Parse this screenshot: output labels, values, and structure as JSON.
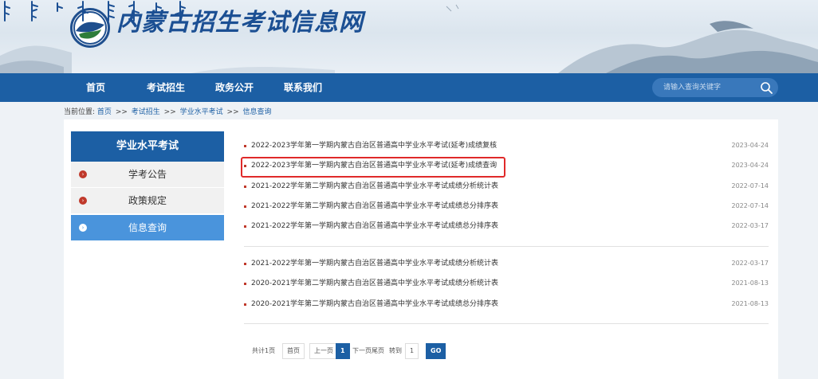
{
  "header": {
    "site_title": "内蒙古招生考试信息网"
  },
  "nav": {
    "items": [
      "首页",
      "考试招生",
      "政务公开",
      "联系我们"
    ],
    "search_placeholder": "请输入查询关键字"
  },
  "breadcrumb": {
    "prefix": "当前位置:",
    "items": [
      "首页",
      "考试招生",
      "学业水平考试",
      "信息查询"
    ],
    "separator": ">>"
  },
  "sidebar": {
    "title": "学业水平考试",
    "items": [
      {
        "label": "学考公告",
        "active": false
      },
      {
        "label": "政策规定",
        "active": false
      },
      {
        "label": "信息查询",
        "active": true
      }
    ]
  },
  "news": [
    {
      "title": "2022-2023学年第一学期内蒙古自治区普通高中学业水平考试(延考)成绩复核",
      "date": "2023-04-24"
    },
    {
      "title": "2022-2023学年第一学期内蒙古自治区普通高中学业水平考试(延考)成绩查询",
      "date": "2023-04-24",
      "highlighted": true
    },
    {
      "title": "2021-2022学年第二学期内蒙古自治区普通高中学业水平考试成绩分析统计表",
      "date": "2022-07-14"
    },
    {
      "title": "2021-2022学年第二学期内蒙古自治区普通高中学业水平考试成绩总分排序表",
      "date": "2022-07-14"
    },
    {
      "title": "2021-2022学年第一学期内蒙古自治区普通高中学业水平考试成绩总分排序表",
      "date": "2022-03-17"
    },
    {
      "title": "2021-2022学年第一学期内蒙古自治区普通高中学业水平考试成绩分析统计表",
      "date": "2022-03-17"
    },
    {
      "title": "2020-2021学年第二学期内蒙古自治区普通高中学业水平考试成绩分析统计表",
      "date": "2021-08-13"
    },
    {
      "title": "2020-2021学年第二学期内蒙古自治区普通高中学业水平考试成绩总分排序表",
      "date": "2021-08-13"
    }
  ],
  "pager": {
    "total": "共计1页",
    "first": "首页",
    "prev": "上一页",
    "current": "1",
    "next_last": "下一页尾页",
    "goto": "转到",
    "goto_value": "1",
    "go": "GO"
  },
  "colors": {
    "nav_bg": "#1c5fa4",
    "sidebar_active": "#4a94dc",
    "bullet": "#c0392b",
    "highlight_border": "#e02a2a"
  }
}
